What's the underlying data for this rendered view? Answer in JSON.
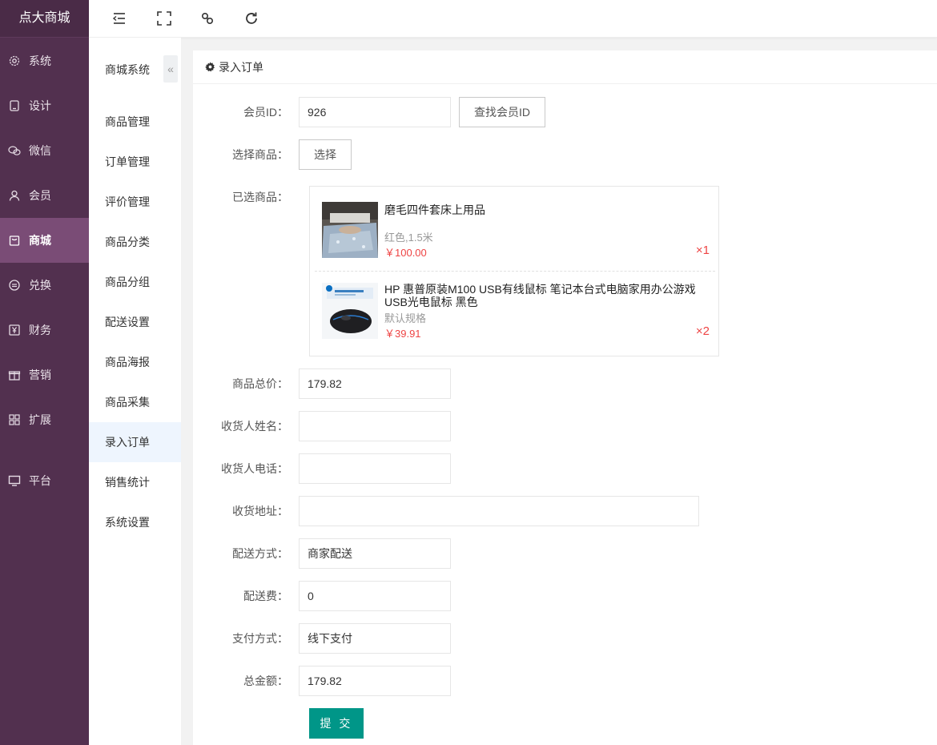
{
  "brand": "点大商城",
  "sidebar": {
    "items": [
      {
        "label": "系统",
        "icon": "gear-icon"
      },
      {
        "label": "设计",
        "icon": "tablet-icon"
      },
      {
        "label": "微信",
        "icon": "wechat-icon"
      },
      {
        "label": "会员",
        "icon": "user-icon"
      },
      {
        "label": "商城",
        "icon": "bag-icon"
      },
      {
        "label": "兑换",
        "icon": "exchange-icon"
      },
      {
        "label": "财务",
        "icon": "yen-icon"
      },
      {
        "label": "营销",
        "icon": "gift-icon"
      },
      {
        "label": "扩展",
        "icon": "grid-icon"
      },
      {
        "label": "平台",
        "icon": "monitor-icon"
      }
    ],
    "active": "商城"
  },
  "subnav": {
    "title": "商城系统",
    "collapse_icon": "double-chevron-left-icon",
    "items": [
      "商品管理",
      "订单管理",
      "评价管理",
      "商品分类",
      "商品分组",
      "配送设置",
      "商品海报",
      "商品采集",
      "录入订单",
      "销售统计",
      "系统设置"
    ],
    "active": "录入订单"
  },
  "topbar": {
    "icons": [
      "menu-fold-icon",
      "fullscreen-icon",
      "link-icon",
      "refresh-icon"
    ]
  },
  "card": {
    "title": "录入订单",
    "title_icon": "gear-icon"
  },
  "form": {
    "member_id": {
      "label": "会员ID：",
      "value": "926",
      "button": "查找会员ID"
    },
    "choose_goods": {
      "label": "选择商品：",
      "button": "选择"
    },
    "selected_goods": {
      "label": "已选商品：",
      "items": [
        {
          "name": "磨毛四件套床上用品",
          "spec": "红色,1.5米",
          "price": "￥100.00",
          "qty": "×1"
        },
        {
          "name": "HP 惠普原装M100 USB有线鼠标 笔记本台式电脑家用办公游戏USB光电鼠标 黑色",
          "spec": "默认规格",
          "price": "￥39.91",
          "qty": "×2"
        }
      ]
    },
    "goods_total": {
      "label": "商品总价：",
      "value": "179.82"
    },
    "receiver_name": {
      "label": "收货人姓名：",
      "value": ""
    },
    "receiver_phone": {
      "label": "收货人电话：",
      "value": ""
    },
    "address": {
      "label": "收货地址：",
      "value": ""
    },
    "delivery_method": {
      "label": "配送方式：",
      "value": "商家配送"
    },
    "delivery_fee": {
      "label": "配送费：",
      "value": "0"
    },
    "payment_method": {
      "label": "支付方式：",
      "value": "线下支付"
    },
    "total_amount": {
      "label": "总金额：",
      "value": "179.82"
    },
    "submit": "提 交"
  },
  "colors": {
    "sidebar_bg": "#52304f",
    "sidebar_active": "#7a4c76",
    "submit": "#009688",
    "price": "#ee4444"
  }
}
